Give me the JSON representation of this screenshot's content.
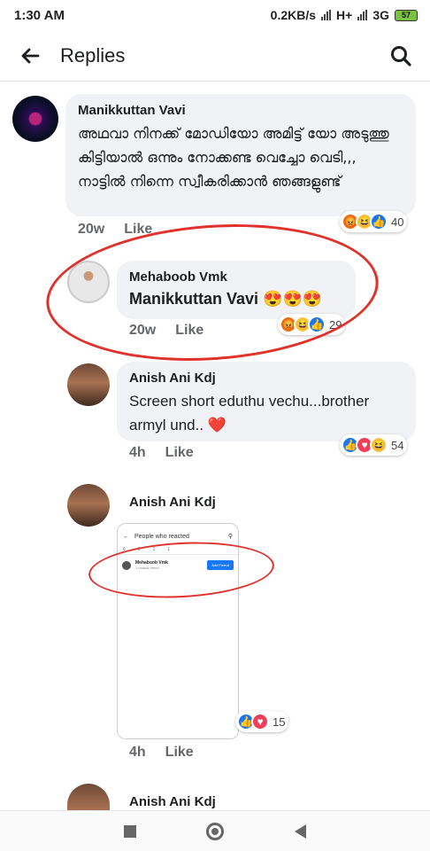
{
  "status_bar": {
    "time": "1:30 AM",
    "net_speed": "0.2KB/s",
    "net_type_1": "H+",
    "net_type_2": "3G",
    "battery": "57"
  },
  "header": {
    "title": "Replies",
    "back_icon": "arrow-left-icon",
    "search_icon": "search-icon"
  },
  "comments": [
    {
      "author": "Manikkuttan Vavi",
      "text": "അഥവാ നിനക്ക് മോഡിയോ അമിട്ട് യോ അടുത്തു കിട്ടിയാൽ ഒന്നും നോക്കണ്ട വെച്ചോ  വെടി,,, നാട്ടിൽ നിന്നെ സ്വീകരിക്കാൻ ഞങ്ങളുണ്ട്",
      "time": "20w",
      "like": "Like",
      "reactions": [
        "angry",
        "haha",
        "like"
      ],
      "count": "40"
    },
    {
      "author": "Mehaboob Vmk",
      "text": "Manikkuttan Vavi 😍😍😍",
      "time": "20w",
      "like": "Like",
      "reactions": [
        "angry",
        "haha",
        "like"
      ],
      "count": "29"
    },
    {
      "author": "Anish Ani Kdj",
      "text": "Screen short eduthu vechu...brother armyl und..  ❤️",
      "time": "4h",
      "like": "Like",
      "reactions": [
        "like",
        "love",
        "haha"
      ],
      "count": "54"
    },
    {
      "author": "Anish Ani Kdj",
      "time": "4h",
      "like": "Like",
      "reactions": [
        "like",
        "love"
      ],
      "count": "15"
    },
    {
      "author": "Anish Ani Kdj"
    }
  ],
  "attached_screenshot": {
    "title": "People who reacted",
    "tabs": [
      "6",
      "3",
      "1",
      "1"
    ],
    "person_name": "Mehaboob Vmk",
    "person_sub": "1 mutual friend",
    "button": "Add Friend"
  },
  "colors": {
    "annotation_circle": "#e0312b",
    "bubble": "#f0f2f5",
    "like_blue": "#1877f2"
  }
}
